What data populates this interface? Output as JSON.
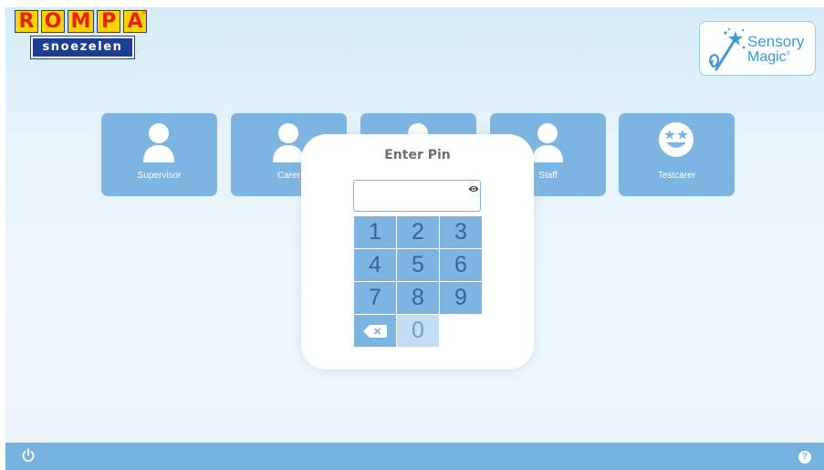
{
  "brand": {
    "logo_letters": [
      "R",
      "O",
      "M",
      "P",
      "A"
    ],
    "logo_sub": "snoezelen",
    "registered": "®"
  },
  "badge": {
    "line1": "Sensory",
    "line2": "Magic",
    "trademark": "®"
  },
  "users": [
    {
      "label": "Supervisor",
      "icon": "person-icon"
    },
    {
      "label": "Carer",
      "icon": "person-icon"
    },
    {
      "label": "",
      "icon": "person-icon"
    },
    {
      "label": "Staff",
      "icon": "person-icon"
    },
    {
      "label": "Testcarer",
      "icon": "star-eyes-smiley-icon"
    }
  ],
  "pin_dialog": {
    "title": "Enter Pin",
    "value": "",
    "placeholder": "",
    "keys": [
      "1",
      "2",
      "3",
      "4",
      "5",
      "6",
      "7",
      "8",
      "9",
      "0"
    ],
    "backspace_icon": "backspace-icon",
    "visibility_icon": "eye-icon"
  },
  "footer": {
    "power_icon": "power-icon",
    "help_label": "?"
  },
  "colors": {
    "tile": "#7db5e2",
    "footer": "#75b2e0",
    "accent_text": "#3d9ad6",
    "logo_yellow": "#ffd100",
    "logo_red": "#e32219",
    "logo_navy": "#1c3f93"
  }
}
